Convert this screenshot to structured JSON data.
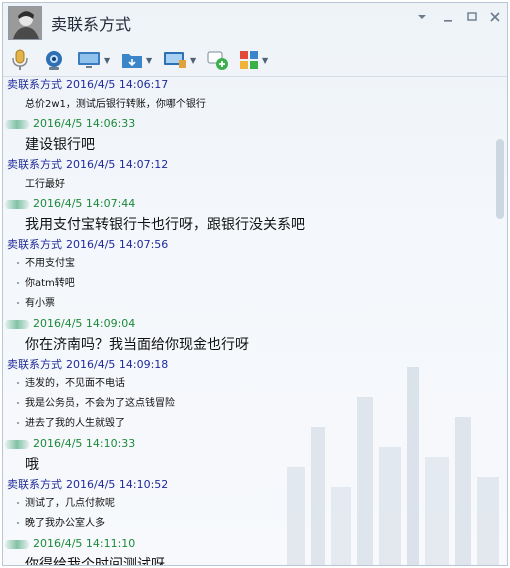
{
  "window": {
    "title": "卖联系方式",
    "controls": [
      "chevron-down-icon",
      "minimize-icon",
      "maximize-icon",
      "close-icon"
    ]
  },
  "toolbar": {
    "buttons": [
      {
        "icon": "microphone-icon",
        "has_menu": false
      },
      {
        "icon": "webcam-icon",
        "has_menu": false
      },
      {
        "icon": "screen-share-icon",
        "has_menu": true
      },
      {
        "icon": "file-transfer-icon",
        "has_menu": true
      },
      {
        "icon": "remote-desktop-icon",
        "has_menu": true
      },
      {
        "icon": "group-chat-icon",
        "has_menu": false
      },
      {
        "icon": "apps-icon",
        "has_menu": true
      }
    ]
  },
  "chat": {
    "messages": [
      {
        "sender": "卖联系方式",
        "time": "2016/4/5 14:06:17",
        "mine": false,
        "size": "s",
        "lines": [
          "总价2w1，测试后银行转账，你哪个银行"
        ]
      },
      {
        "sender": "",
        "time": "2016/4/5 14:06:33",
        "mine": true,
        "size": "l",
        "lines": [
          "建设银行吧"
        ]
      },
      {
        "sender": "卖联系方式",
        "time": "2016/4/5 14:07:12",
        "mine": false,
        "size": "s",
        "lines": [
          "工行最好"
        ]
      },
      {
        "sender": "",
        "time": "2016/4/5 14:07:44",
        "mine": true,
        "size": "l",
        "lines": [
          "我用支付宝转银行卡也行呀，跟银行没关系吧"
        ]
      },
      {
        "sender": "卖联系方式",
        "time": "2016/4/5 14:07:56",
        "mine": false,
        "size": "b",
        "lines": [
          "不用支付宝",
          "你atm转吧",
          "有小票"
        ]
      },
      {
        "sender": "",
        "time": "2016/4/5 14:09:04",
        "mine": true,
        "size": "l",
        "lines": [
          "你在济南吗？我当面给你现金也行呀"
        ]
      },
      {
        "sender": "卖联系方式",
        "time": "2016/4/5 14:09:18",
        "mine": false,
        "size": "b",
        "lines": [
          "违发的，不见面不电话",
          "我是公务员，不会为了这点钱冒险",
          "进去了我的人生就毁了"
        ]
      },
      {
        "sender": "",
        "time": "2016/4/5 14:10:33",
        "mine": true,
        "size": "l",
        "lines": [
          "哦"
        ]
      },
      {
        "sender": "卖联系方式",
        "time": "2016/4/5 14:10:52",
        "mine": false,
        "size": "b",
        "lines": [
          "测试了，几点付款呢",
          "晚了我办公室人多"
        ]
      },
      {
        "sender": "",
        "time": "2016/4/5 14:11:10",
        "mine": true,
        "size": "l",
        "lines": [
          "你得给我个时间测试呀"
        ]
      }
    ]
  }
}
